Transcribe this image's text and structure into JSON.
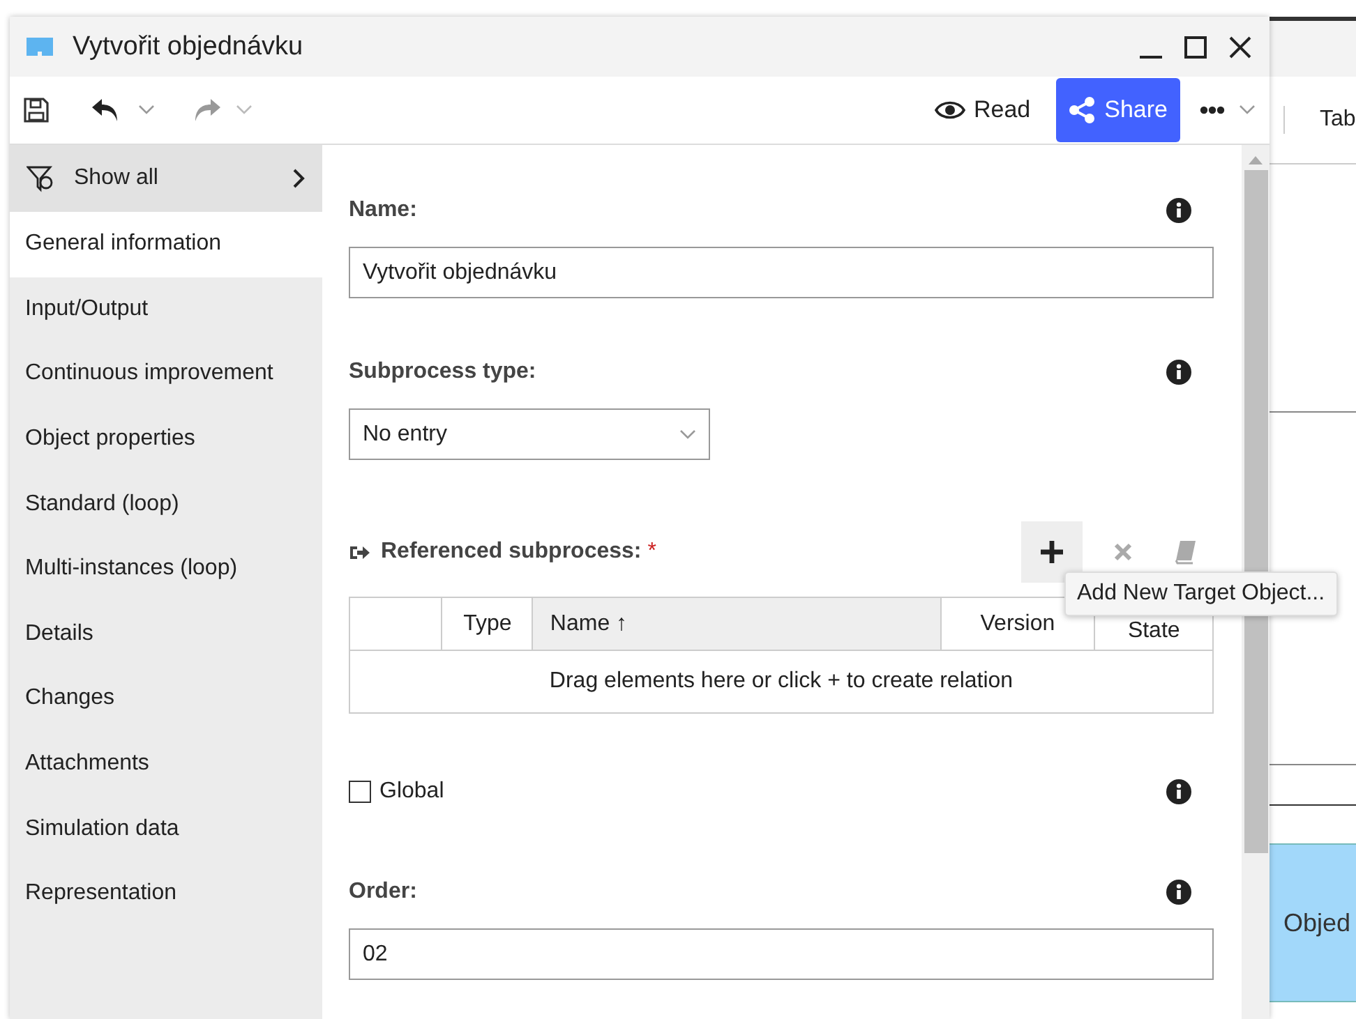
{
  "window": {
    "title": "Vytvořit objednávku"
  },
  "toolbar": {
    "read": "Read",
    "share": "Share"
  },
  "sidebar": {
    "show_all": "Show all",
    "items": [
      {
        "label": "General information",
        "selected": true
      },
      {
        "label": "Input/Output",
        "selected": false
      },
      {
        "label": "Continuous improvement",
        "selected": false
      },
      {
        "label": "Object properties",
        "selected": false
      },
      {
        "label": "Standard (loop)",
        "selected": false
      },
      {
        "label": "Multi-instances (loop)",
        "selected": false
      },
      {
        "label": "Details",
        "selected": false
      },
      {
        "label": "Changes",
        "selected": false
      },
      {
        "label": "Attachments",
        "selected": false
      },
      {
        "label": "Simulation data",
        "selected": false
      },
      {
        "label": "Representation",
        "selected": false
      }
    ]
  },
  "form": {
    "name": {
      "label": "Name:",
      "value": "Vytvořit objednávku"
    },
    "subprocess_type": {
      "label": "Subprocess type:",
      "value": "No entry"
    },
    "referenced_subprocess": {
      "label": "Referenced subprocess:",
      "required": "*",
      "columns": [
        "Type",
        "Name ↑",
        "Version",
        "State"
      ],
      "empty_message": "Drag elements here or click + to create relation",
      "tooltip": "Add New Target Object..."
    },
    "global": {
      "label": "Global",
      "checked": false
    },
    "order": {
      "label": "Order:",
      "value": "02"
    }
  },
  "background": {
    "tab": "Tab",
    "object": "Objed"
  }
}
